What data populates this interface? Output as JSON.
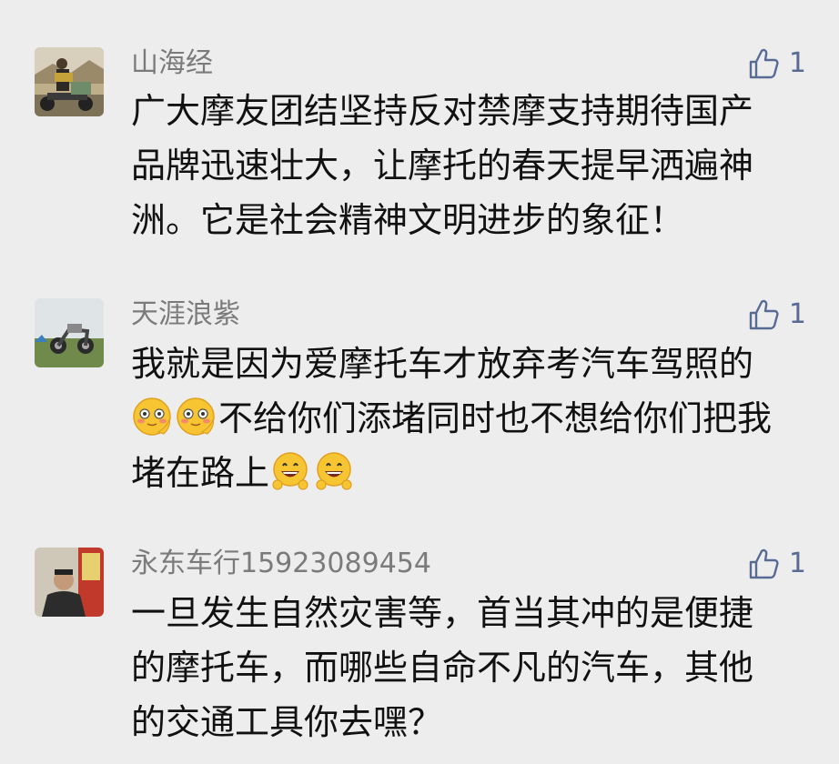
{
  "comments": [
    {
      "name": "山海经",
      "likes": "1",
      "text_lines": [
        "广大摩友团结坚持反对禁摩支持期待国产",
        "品牌迅速壮大，让摩托的春天提早洒遍神",
        "洲。它是社会精神文明进步的象征！"
      ]
    },
    {
      "name": "天涯浪紫",
      "likes": "1",
      "text_lines": [
        "我就是因为爱摩托车才放弃考汽车驾照的",
        "不给你们添堵同时也不想给你们把我",
        "堵在路上"
      ],
      "emojis": [
        "shy-face",
        "grinning-face"
      ]
    },
    {
      "name": "永东车行15923089454",
      "likes": "1",
      "text_lines": [
        "一旦发生自然灾害等，首当其冲的是便捷",
        "的摩托车，而哪些自命不凡的汽车，其他",
        "的交通工具你去嘿？"
      ]
    }
  ],
  "colors": {
    "background": "#ededed",
    "name": "#7b7b7b",
    "text": "#111111",
    "like": "#586b95"
  }
}
